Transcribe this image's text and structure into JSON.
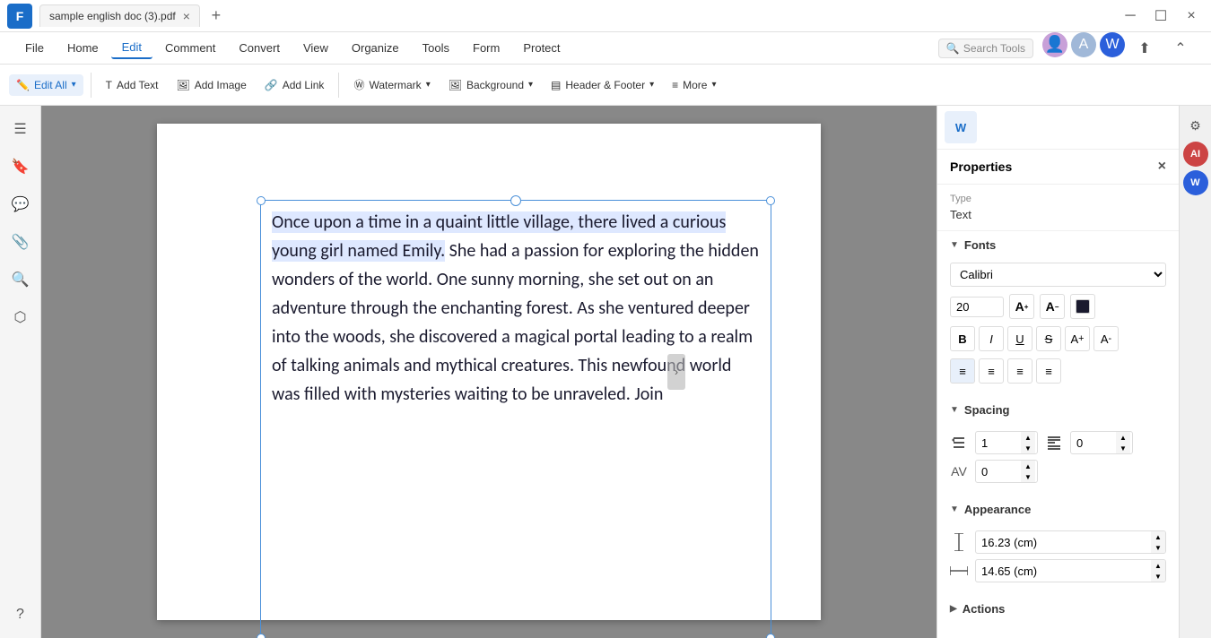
{
  "titlebar": {
    "logo": "F",
    "tab_title": "sample english doc (3).pdf",
    "close_icon": "×",
    "add_tab_icon": "+",
    "minimize_icon": "─",
    "maximize_icon": "☐",
    "window_close_icon": "×"
  },
  "menubar": {
    "items": [
      "File",
      "Home",
      "Edit",
      "Comment",
      "Convert",
      "View",
      "Organize",
      "Tools",
      "Form",
      "Protect"
    ],
    "active": "Edit",
    "search_placeholder": "Search Tools"
  },
  "toolbar": {
    "edit_all_label": "Edit All",
    "add_text_label": "Add Text",
    "add_image_label": "Add Image",
    "add_link_label": "Add Link",
    "watermark_label": "Watermark",
    "background_label": "Background",
    "header_footer_label": "Header & Footer",
    "more_label": "More"
  },
  "sidebar_icons": [
    "☰",
    "🔖",
    "💬",
    "📎",
    "🔍",
    "⬡"
  ],
  "content": {
    "text": "Once upon a time in a quaint little village, there lived a curious young girl named Emily. She had a passion for exploring the hidden wonders of the world. One sunny morning, she set out on an adventure through the enchanting forest. As she ventured deeper into the woods, she discovered a magical portal leading to a realm of talking animals and mythical creatures. This newfound world was filled with mysteries waiting to be unraveled. Join"
  },
  "properties": {
    "panel_title": "Properties",
    "type_label": "Type",
    "type_value": "Text",
    "fonts_section": "Fonts",
    "font_family": "Calibri",
    "font_size": "20",
    "bold_label": "B",
    "italic_label": "I",
    "underline_label": "U",
    "strikethrough_label": "S",
    "superscript_label": "A",
    "subscript_label": "A",
    "spacing_section": "Spacing",
    "line_spacing_value": "1",
    "paragraph_spacing_value": "0",
    "char_spacing_value": "0",
    "appearance_section": "Appearance",
    "height_value": "16.23 (cm)",
    "width_value": "14.65 (cm)",
    "actions_section": "Actions"
  }
}
